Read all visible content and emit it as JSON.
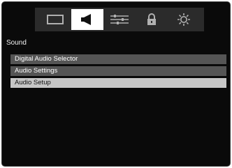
{
  "tabs": [
    {
      "icon": "picture-icon",
      "active": false
    },
    {
      "icon": "speaker-icon",
      "active": true
    },
    {
      "icon": "settings-sliders-icon",
      "active": false
    },
    {
      "icon": "lock-icon",
      "active": false
    },
    {
      "icon": "gear-icon",
      "active": false
    }
  ],
  "section": {
    "title": "Sound"
  },
  "menu": {
    "items": [
      {
        "label": "Digital Audio Selector",
        "selected": false
      },
      {
        "label": "Audio Settings",
        "selected": false
      },
      {
        "label": "Audio Setup",
        "selected": true
      }
    ]
  },
  "colors": {
    "background": "#0a0a0a",
    "tabbar": "#2b2b2b",
    "tab_active": "#ffffff",
    "icon": "#b0b0b0",
    "icon_active": "#111111",
    "item": "#555555",
    "item_selected": "#c6c6c6"
  }
}
